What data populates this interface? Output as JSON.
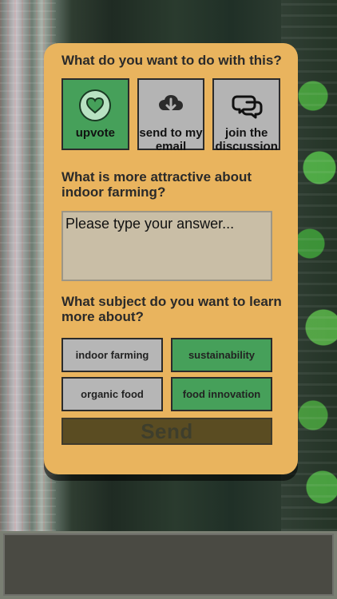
{
  "card": {
    "question_action": "What do you want to do with this?",
    "actions": [
      {
        "label": "upvote",
        "icon": "heart-icon",
        "style": "green"
      },
      {
        "label": "send to my email",
        "icon": "cloud-download-icon",
        "style": "gray"
      },
      {
        "label": "join the discussion",
        "icon": "chat-bubbles-icon",
        "style": "gray"
      }
    ],
    "question_attractive": "What is more attractive about indoor farming?",
    "answer_placeholder": "Please type your answer...",
    "question_subject": "What subject do you want to learn more about?",
    "subjects": [
      {
        "label": "indoor farming",
        "style": "gray"
      },
      {
        "label": "sustainability",
        "style": "green"
      },
      {
        "label": "organic food",
        "style": "gray"
      },
      {
        "label": "food innovation",
        "style": "green"
      }
    ],
    "send_label": "Send"
  },
  "colors": {
    "card_bg": "#e9b45e",
    "green": "#46a05a",
    "gray": "#b6b6b6",
    "send_bg": "#5a4c22"
  }
}
